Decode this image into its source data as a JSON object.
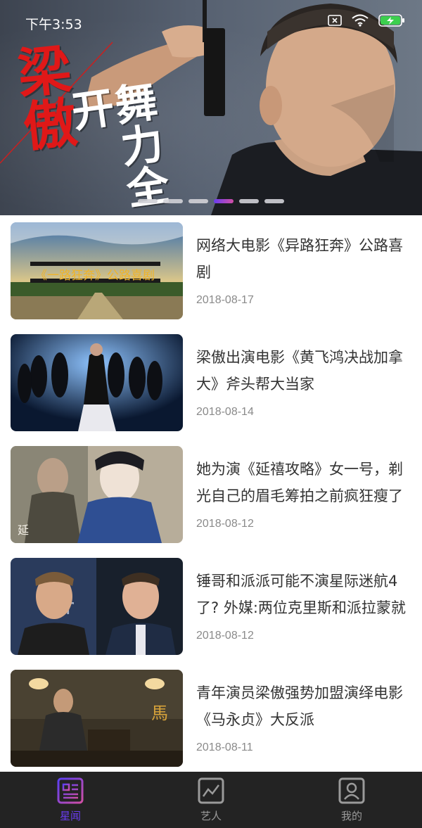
{
  "status_bar": {
    "time": "下午3:53",
    "icons": [
      "sim-off-icon",
      "wifi-icon",
      "battery-charging-icon"
    ]
  },
  "banner": {
    "title_red": "梁傲",
    "title_white": "舞力全开",
    "slide_count": 6,
    "active_slide": 4,
    "accent_colors": [
      "#e01818",
      "#6a3cf0"
    ]
  },
  "news": [
    {
      "title": "网络大电影《异路狂奔》公路喜剧",
      "date": "2018-08-17",
      "thumb_caption": "《一路狂奔》公路喜剧"
    },
    {
      "title": "梁傲出演电影《黄飞鸿决战加拿大》斧头帮大当家",
      "date": "2018-08-14"
    },
    {
      "title": "她为演《延禧攻略》女一号，剃光自己的眉毛筹拍之前疯狂瘦了",
      "date": "2018-08-12"
    },
    {
      "title": "锤哥和派派可能不演星际迷航4了? 外媒:两位克里斯和派拉蒙就",
      "date": "2018-08-12"
    },
    {
      "title": "青年演员梁傲强势加盟演绎电影《马永贞》大反派",
      "date": "2018-08-11"
    }
  ],
  "nav": {
    "items": [
      {
        "label": "星闻",
        "icon": "news-icon",
        "active": true
      },
      {
        "label": "艺人",
        "icon": "chart-icon",
        "active": false
      },
      {
        "label": "我的",
        "icon": "profile-icon",
        "active": false
      }
    ],
    "active_color": "#6a3cf0"
  }
}
